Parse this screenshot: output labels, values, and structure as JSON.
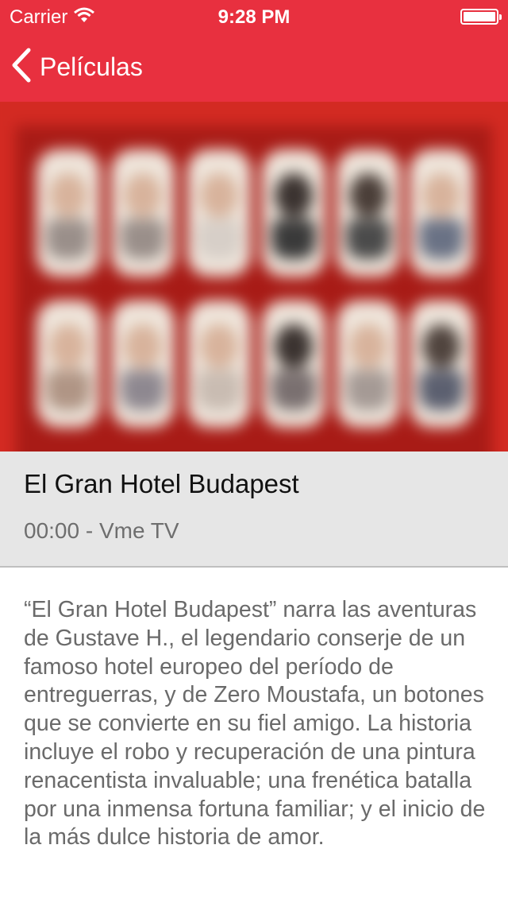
{
  "status_bar": {
    "carrier": "Carrier",
    "time": "9:28 PM",
    "icons": [
      "wifi-icon",
      "battery-icon"
    ]
  },
  "nav": {
    "back_label": "Películas",
    "icon": "chevron-left-icon"
  },
  "colors": {
    "accent": "#e8303f",
    "info_background": "#e6e6e6",
    "text_primary": "#111111",
    "text_secondary": "#6e6e6e"
  },
  "movie": {
    "title": "El Gran Hotel Budapest",
    "meta": "00:00 - Vme TV",
    "description": "“El Gran Hotel Budapest” narra las aventuras de Gustave H., el legendario conserje de un famoso hotel europeo del período de entreguerras, y de Zero Moustafa, un botones que se convierte en su fiel amigo.  La historia incluye el robo y recuperación de una pintura renacentista invaluable; una frenética batalla por una inmensa fortuna familiar; y el inicio de la más dulce historia de amor."
  }
}
